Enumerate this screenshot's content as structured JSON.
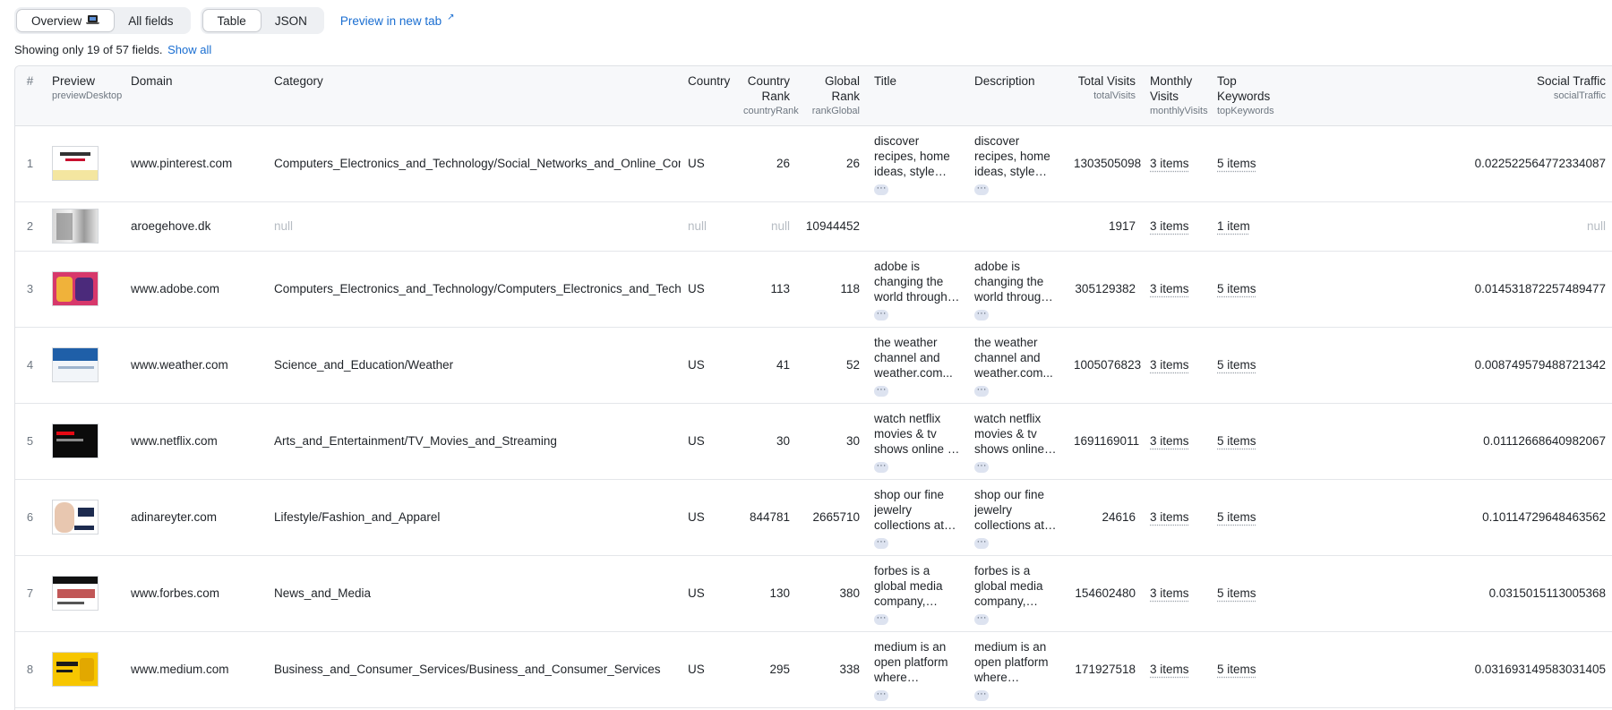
{
  "toolbar": {
    "view_tabs": [
      {
        "label": "Overview",
        "icon": "laptop-icon",
        "active": true
      },
      {
        "label": "All fields",
        "active": false
      }
    ],
    "format_tabs": [
      {
        "label": "Table",
        "active": true
      },
      {
        "label": "JSON",
        "active": false
      }
    ],
    "preview_link": "Preview in new tab",
    "preview_icon": "external-link-icon"
  },
  "fields_note": {
    "text": "Showing only 19 of 57 fields.",
    "show_all": "Show all"
  },
  "table": {
    "columns": [
      {
        "key": "idx",
        "label": "#",
        "sub": ""
      },
      {
        "key": "preview",
        "label": "Preview",
        "sub": "previewDesktop"
      },
      {
        "key": "domain",
        "label": "Domain",
        "sub": ""
      },
      {
        "key": "category",
        "label": "Category",
        "sub": ""
      },
      {
        "key": "country",
        "label": "Country",
        "sub": ""
      },
      {
        "key": "countryRank",
        "label": "Country Rank",
        "sub": "countryRank"
      },
      {
        "key": "globalRank",
        "label": "Global Rank",
        "sub": "rankGlobal"
      },
      {
        "key": "title",
        "label": "Title",
        "sub": ""
      },
      {
        "key": "description",
        "label": "Description",
        "sub": ""
      },
      {
        "key": "totalVisits",
        "label": "Total Visits",
        "sub": "totalVisits"
      },
      {
        "key": "monthlyVisits",
        "label": "Monthly Visits",
        "sub": "monthlyVisits"
      },
      {
        "key": "topKeywords",
        "label": "Top Keywords",
        "sub": "topKeywords"
      },
      {
        "key": "socialTraffic",
        "label": "Social Traffic",
        "sub": "socialTraffic"
      }
    ],
    "more_glyph": "···",
    "rows": [
      {
        "idx": "1",
        "thumb": "t1",
        "domain": "www.pinterest.com",
        "category": "Computers_Electronics_and_Technology/Social_Networks_and_Online_Communities",
        "country": "US",
        "countryRank": "26",
        "globalRank": "26",
        "title": "discover recipes, home ideas, style inspiration and...",
        "description": "discover recipes, home ideas, style inspiration and...",
        "totalVisits": "1303505098",
        "monthlyVisits": "3 items",
        "topKeywords": "5 items",
        "socialTraffic": "0.022522564772334087"
      },
      {
        "idx": "2",
        "thumb": "t2",
        "domain": "aroegehove.dk",
        "category": "null",
        "country": "null",
        "countryRank": "null",
        "globalRank": "10944452",
        "title": "",
        "description": "",
        "totalVisits": "1917",
        "monthlyVisits": "3 items",
        "topKeywords": "1 item",
        "socialTraffic": "null"
      },
      {
        "idx": "3",
        "thumb": "t3",
        "domain": "www.adobe.com",
        "category": "Computers_Electronics_and_Technology/Computers_Electronics_and_Technology",
        "country": "US",
        "countryRank": "113",
        "globalRank": "118",
        "title": "adobe is changing the world through digital...",
        "description": "adobe is changing the world through digital...",
        "totalVisits": "305129382",
        "monthlyVisits": "3 items",
        "topKeywords": "5 items",
        "socialTraffic": "0.014531872257489477"
      },
      {
        "idx": "4",
        "thumb": "t4",
        "domain": "www.weather.com",
        "category": "Science_and_Education/Weather",
        "country": "US",
        "countryRank": "41",
        "globalRank": "52",
        "title": "the weather channel and weather.com...",
        "description": "the weather channel and weather.com...",
        "totalVisits": "1005076823",
        "monthlyVisits": "3 items",
        "topKeywords": "5 items",
        "socialTraffic": "0.008749579488721342"
      },
      {
        "idx": "5",
        "thumb": "t5",
        "domain": "www.netflix.com",
        "category": "Arts_and_Entertainment/TV_Movies_and_Streaming",
        "country": "US",
        "countryRank": "30",
        "globalRank": "30",
        "title": "watch netflix movies & tv shows online or stream...",
        "description": "watch netflix movies & tv shows online or stream...",
        "totalVisits": "1691169011",
        "monthlyVisits": "3 items",
        "topKeywords": "5 items",
        "socialTraffic": "0.01112668640982067"
      },
      {
        "idx": "6",
        "thumb": "t6",
        "domain": "adinareyter.com",
        "category": "Lifestyle/Fashion_and_Apparel",
        "country": "US",
        "countryRank": "844781",
        "globalRank": "2665710",
        "title": "shop our fine jewelry collections at adina reyter...",
        "description": "shop our fine jewelry collections at adina reyter...",
        "totalVisits": "24616",
        "monthlyVisits": "3 items",
        "topKeywords": "5 items",
        "socialTraffic": "0.10114729648463562"
      },
      {
        "idx": "7",
        "thumb": "t7",
        "domain": "www.forbes.com",
        "category": "News_and_Media",
        "country": "US",
        "countryRank": "130",
        "globalRank": "380",
        "title": "forbes is a global media company, focusing on...",
        "description": "forbes is a global media company, focusing on...",
        "totalVisits": "154602480",
        "monthlyVisits": "3 items",
        "topKeywords": "5 items",
        "socialTraffic": "0.0315015113005368"
      },
      {
        "idx": "8",
        "thumb": "t8",
        "domain": "www.medium.com",
        "category": "Business_and_Consumer_Services/Business_and_Consumer_Services",
        "country": "US",
        "countryRank": "295",
        "globalRank": "338",
        "title": "medium is an open platform where readers...",
        "description": "medium is an open platform where readers...",
        "totalVisits": "171927518",
        "monthlyVisits": "3 items",
        "topKeywords": "5 items",
        "socialTraffic": "0.031693149583031405"
      }
    ]
  }
}
